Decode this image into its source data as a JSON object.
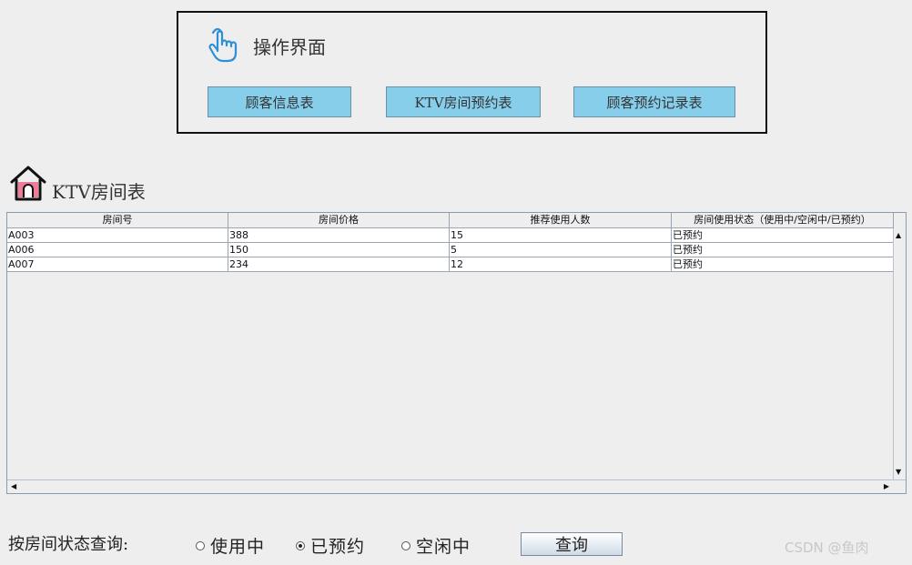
{
  "panel": {
    "title": "操作界面",
    "buttons": [
      "顾客信息表",
      "KTV房间预约表",
      "顾客预约记录表"
    ]
  },
  "section": {
    "title": "KTV房间表"
  },
  "table": {
    "columns": [
      "房间号",
      "房间价格",
      "推荐使用人数",
      "房间使用状态（使用中/空闲中/已预约）"
    ],
    "rows": [
      [
        "A003",
        "388",
        "15",
        "已预约"
      ],
      [
        "A006",
        "150",
        "5",
        "已预约"
      ],
      [
        "A007",
        "234",
        "12",
        "已预约"
      ]
    ]
  },
  "query": {
    "label": "按房间状态查询:",
    "options": [
      {
        "label": "使用中",
        "checked": false
      },
      {
        "label": "已预约",
        "checked": true
      },
      {
        "label": "空闲中",
        "checked": false
      }
    ],
    "button": "查询"
  },
  "watermark": "CSDN @鱼肉"
}
